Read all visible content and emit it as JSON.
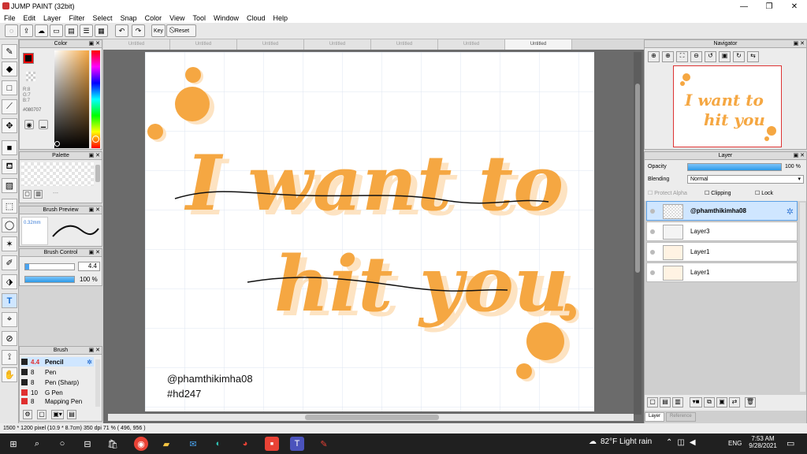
{
  "window": {
    "title": "JUMP PAINT (32bit)"
  },
  "menu": [
    "File",
    "Edit",
    "Layer",
    "Filter",
    "Select",
    "Snap",
    "Color",
    "View",
    "Tool",
    "Window",
    "Cloud",
    "Help"
  ],
  "toolbar": {
    "key_label": "Key",
    "reset_label": "Reset"
  },
  "color_panel": {
    "title": "Color",
    "r": "R:8",
    "g": "G:7",
    "b": "B:7",
    "hex": "#080707",
    "fg_color": "#080707"
  },
  "palette_panel": {
    "title": "Palette",
    "dashes": "---"
  },
  "brush_preview": {
    "title": "Brush Preview",
    "size": "0.32mm"
  },
  "brush_control": {
    "title": "Brush Control",
    "size": "4.4",
    "opacity": "100 %"
  },
  "brush_list": {
    "title": "Brush",
    "items": [
      {
        "size": "4.4",
        "name": "Pencil",
        "color": "#222222",
        "selected": true
      },
      {
        "size": "8",
        "name": "Pen",
        "color": "#222222"
      },
      {
        "size": "8",
        "name": "Pen (Sharp)",
        "color": "#222222"
      },
      {
        "size": "10",
        "name": "G Pen",
        "color": "#e03030"
      },
      {
        "size": "8",
        "name": "Mapping Pen",
        "color": "#e03030"
      }
    ]
  },
  "tabs": [
    "Untitled",
    "Untitled",
    "Untitled",
    "Untitled",
    "Untitled",
    "Untitled",
    "Untitled"
  ],
  "canvas": {
    "line1": "I want to",
    "line2": "hit you",
    "handle": "@phamthikimha08",
    "tag": "#hd247",
    "accent": "#f5a742"
  },
  "navigator": {
    "title": "Navigator"
  },
  "layer_panel": {
    "title": "Layer",
    "opacity_label": "Opacity",
    "opacity_value": "100 %",
    "blending_label": "Blending",
    "blending_value": "Normal",
    "protect_alpha": "Protect Alpha",
    "clipping": "Clipping",
    "lock": "Lock",
    "layers": [
      {
        "name": "@phamthikimha08",
        "selected": true
      },
      {
        "name": "Layer3"
      },
      {
        "name": "Layer1"
      },
      {
        "name": "Layer1"
      }
    ],
    "bottom_tabs": [
      "Layer",
      "Reference"
    ]
  },
  "status": {
    "text": "1500 * 1200 pixel   (10.9 * 8.7cm)   350 dpi   71 %   ( 496, 956 )"
  },
  "taskbar": {
    "weather": "82°F  Light rain",
    "lang": "ENG",
    "time": "7:53 AM",
    "date": "9/28/2021"
  }
}
